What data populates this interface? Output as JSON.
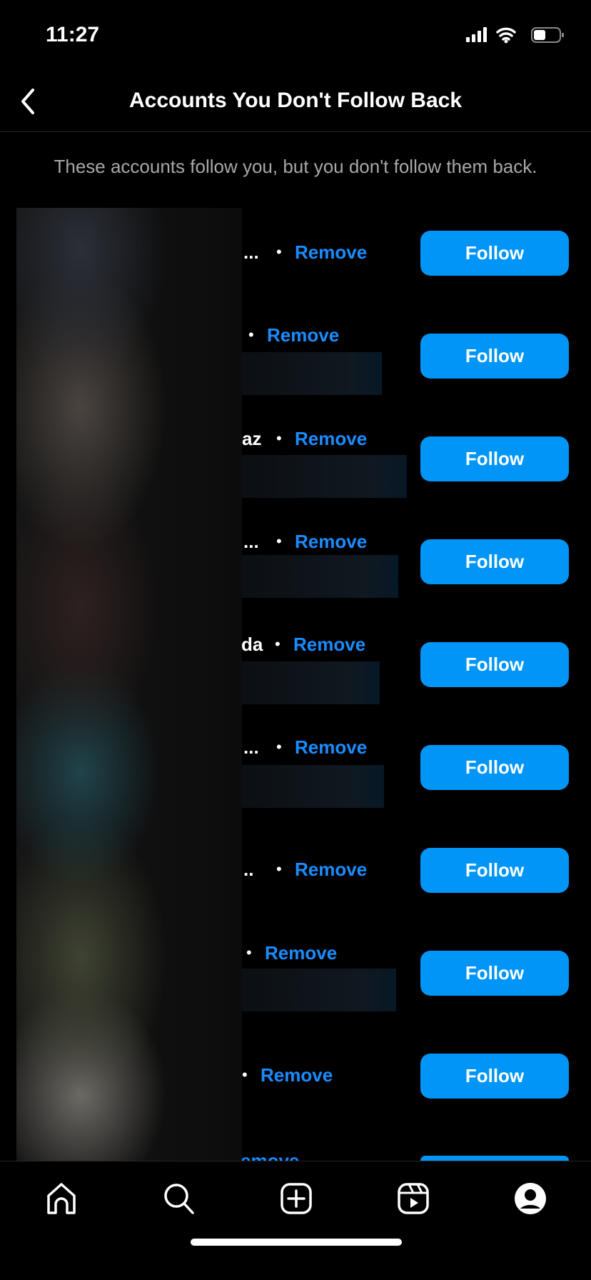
{
  "status": {
    "time": "11:27"
  },
  "header": {
    "title": "Accounts You Don't Follow Back"
  },
  "subtitle": "These accounts follow you, but you don't follow them back.",
  "rows": [
    {
      "name_fragment": "...",
      "remove": "Remove",
      "follow": "Follow"
    },
    {
      "name_fragment": "",
      "remove": "Remove",
      "follow": "Follow"
    },
    {
      "name_fragment": "az",
      "remove": "Remove",
      "follow": "Follow"
    },
    {
      "name_fragment": "...",
      "remove": "Remove",
      "follow": "Follow"
    },
    {
      "name_fragment": "da",
      "remove": "Remove",
      "follow": "Follow"
    },
    {
      "name_fragment": "...",
      "remove": "Remove",
      "follow": "Follow"
    },
    {
      "name_fragment": "..",
      "remove": "Remove",
      "follow": "Follow"
    },
    {
      "name_fragment": "",
      "remove": "Remove",
      "follow": "Follow"
    },
    {
      "name_fragment": "",
      "remove": "Remove",
      "follow": "Follow"
    },
    {
      "name_fragment": "",
      "remove": "emove",
      "follow": ""
    }
  ],
  "colors": {
    "accent": "#0095f6",
    "link": "#1a8cff",
    "background": "#000000"
  },
  "tabs": [
    "home-icon",
    "search-icon",
    "create-icon",
    "reels-icon",
    "profile-icon"
  ]
}
